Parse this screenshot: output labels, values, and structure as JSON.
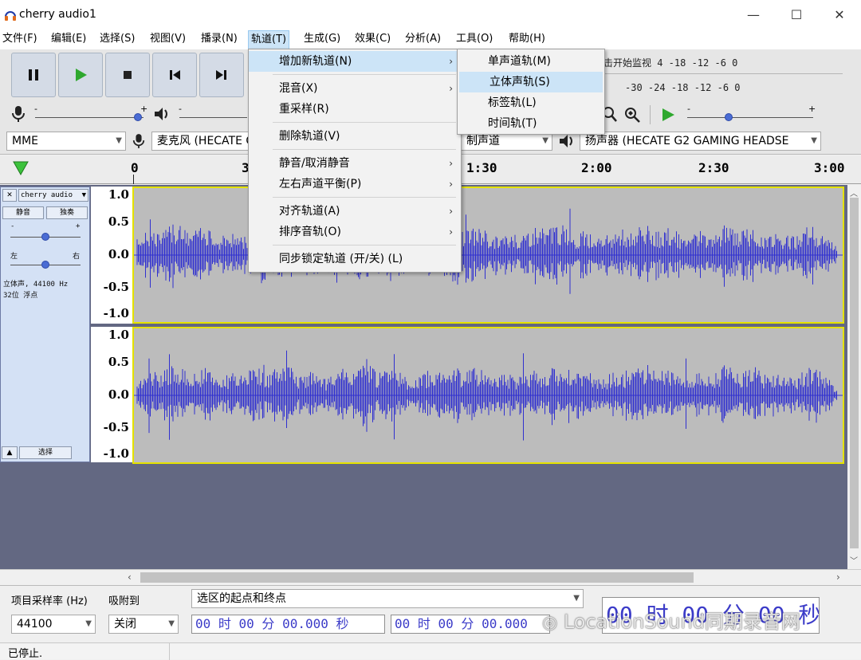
{
  "window": {
    "title": "cherry audio1",
    "minimize": "—",
    "maximize": "☐",
    "close": "✕"
  },
  "menubar": [
    "文件(F)",
    "编辑(E)",
    "选择(S)",
    "视图(V)",
    "播录(N)",
    "轨道(T)",
    "生成(G)",
    "效果(C)",
    "分析(A)",
    "工具(O)",
    "帮助(H)"
  ],
  "toolbar": {
    "host": "MME",
    "mic_device": "麦克风 (HECATE G",
    "channels": "制声道",
    "speaker_device": "扬声器 (HECATE G2 GAMING HEADSE",
    "meter_row1": "击开始监视 4  -18  -12   -6   0",
    "meter_row2": "-30  -24  -18  -12   -6   0",
    "slider_minus": "-",
    "slider_plus": "+"
  },
  "ruler": {
    "ticks": [
      "0",
      "3",
      "1:30",
      "2:00",
      "2:30",
      "3:00"
    ]
  },
  "track": {
    "name": "cherry audio",
    "mute": "静音",
    "solo": "独奏",
    "left": "左",
    "right": "右",
    "info1": "立体声, 44100 Hz",
    "info2": "32位 浮点",
    "select": "选择",
    "vlabels": [
      "1.0",
      "0.5",
      "0.0",
      "-0.5",
      "-1.0"
    ]
  },
  "bottom": {
    "rate_label": "项目采样率 (Hz)",
    "snap_label": "吸附到",
    "rate_value": "44100",
    "snap_value": "关闭",
    "selection_label": "选区的起点和终点",
    "time1": "00 时 00 分 00.000 秒",
    "time2": "00 时 00 分 00.000",
    "big_time": "00 时 00 分 00 秒"
  },
  "status": "已停止.",
  "track_menu": {
    "items": [
      {
        "label": "增加新轨道(N)",
        "sub": "›"
      },
      {
        "label": "混音(X)",
        "sub": "›"
      },
      {
        "label": "重采样(R)",
        "sub": ""
      },
      {
        "label": "删除轨道(V)",
        "sub": ""
      },
      {
        "label": "静音/取消静音",
        "sub": "›"
      },
      {
        "label": "左右声道平衡(P)",
        "sub": "›"
      },
      {
        "label": "对齐轨道(A)",
        "sub": "›"
      },
      {
        "label": "排序音轨(O)",
        "sub": "›"
      },
      {
        "label": "同步锁定轨道 (开/关) (L)",
        "sub": ""
      }
    ]
  },
  "submenu": {
    "items": [
      "单声道轨(M)",
      "立体声轨(S)",
      "标签轨(L)",
      "时间轨(T)"
    ]
  },
  "watermark": "LocationSound同期录音网",
  "colors": {
    "wave": "#3030d0",
    "track_bg": "#bcbcbc",
    "selection_border": "#e5e200",
    "menu_highlight": "#cce4f7"
  }
}
